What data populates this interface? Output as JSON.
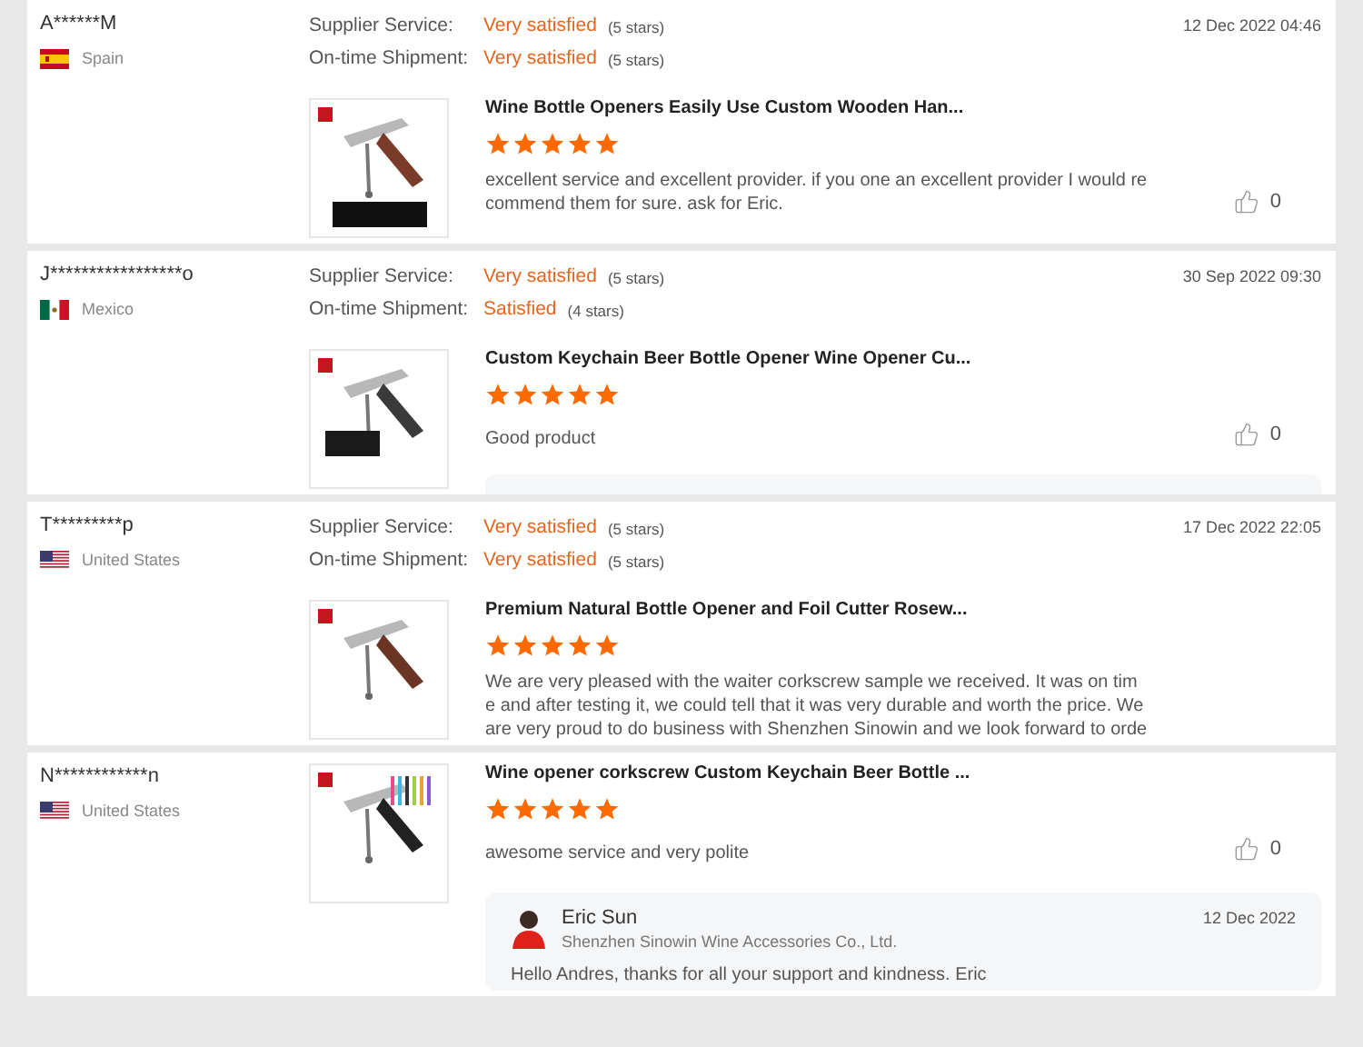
{
  "reviews": [
    {
      "buyer": "A******M",
      "country": "Spain",
      "flag": {
        "kind": "spain"
      },
      "date": "12 Dec 2022 04:46",
      "ratings": [
        {
          "label": "Supplier Service:",
          "value": "Very satisfied",
          "count": "(5 stars)"
        },
        {
          "label": "On-time Shipment:",
          "value": "Very satisfied",
          "count": "(5 stars)"
        }
      ],
      "product": "Wine Bottle Openers Easily Use Custom Wooden Han...",
      "stars": 5,
      "text_lines": [
        "excellent service and excellent provider. if you one an excellent provider I would re",
        "commend them for sure. ask for Eric."
      ],
      "likes": "0"
    },
    {
      "buyer": "J*****************o",
      "country": "Mexico",
      "flag": {
        "kind": "mexico"
      },
      "date": "30 Sep 2022 09:30",
      "ratings": [
        {
          "label": "Supplier Service:",
          "value": "Very satisfied",
          "count": "(5 stars)"
        },
        {
          "label": "On-time Shipment:",
          "value": "Satisfied",
          "count": "(4 stars)"
        }
      ],
      "product": "Custom Keychain Beer Bottle Opener Wine Opener Cu...",
      "stars": 5,
      "text_lines": [
        "Good product"
      ],
      "likes": "0",
      "reply": {
        "kind": "cut"
      }
    },
    {
      "buyer": "T*********p",
      "country": "United States",
      "flag": {
        "kind": "us"
      },
      "date": "17 Dec 2022 22:05",
      "ratings": [
        {
          "label": "Supplier Service:",
          "value": "Very satisfied",
          "count": "(5 stars)"
        },
        {
          "label": "On-time Shipment:",
          "value": "Very satisfied",
          "count": "(5 stars)"
        }
      ],
      "product": "Premium Natural Bottle Opener and Foil Cutter Rosew...",
      "stars": 5,
      "text_lines": [
        "We are very pleased with the waiter corkscrew sample we received. It was on tim",
        "e and after testing it, we could tell that it was very durable and worth the price. We",
        "are very proud to do business with Shenzhen Sinowin and we look forward to orde"
      ]
    },
    {
      "buyer": "N************n",
      "country": "United States",
      "flag": {
        "kind": "us"
      },
      "product": "Wine opener corkscrew Custom Keychain Beer Bottle ...",
      "stars": 5,
      "text_lines": [
        "awesome service and very polite"
      ],
      "likes": "0",
      "reply": {
        "kind": "full",
        "name": "Eric Sun",
        "company": "Shenzhen Sinowin Wine Accessories Co., Ltd.",
        "date": "12 Dec 2022",
        "text": "Hello Andres, thanks for all your support and kindness. Eric"
      }
    }
  ]
}
